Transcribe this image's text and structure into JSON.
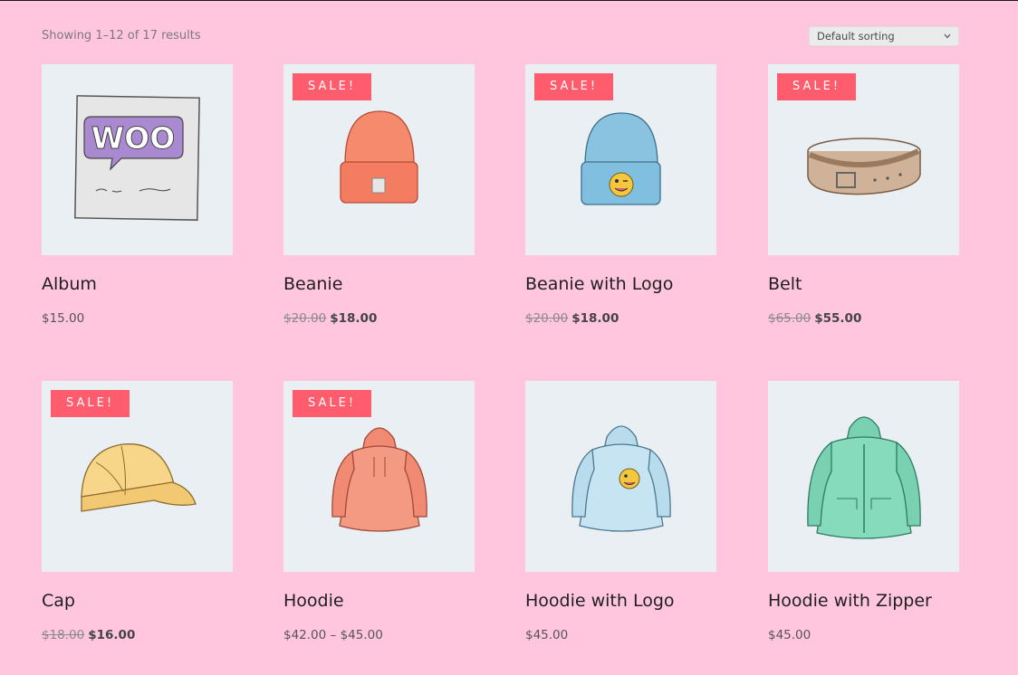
{
  "result_count": "Showing 1–12 of 17 results",
  "sorting": {
    "selected": "Default sorting"
  },
  "colors": {
    "background": "#ffc6de",
    "card": "#e9eff3",
    "sale_badge": "#ff5c6d"
  },
  "sale_label": "SALE!",
  "products": [
    {
      "title": "Album",
      "image": "album-icon",
      "sale": false,
      "price": "$15.00"
    },
    {
      "title": "Beanie",
      "image": "beanie-icon",
      "sale": true,
      "old_price": "$20.00",
      "new_price": "$18.00"
    },
    {
      "title": "Beanie with Logo",
      "image": "beanie-logo-icon",
      "sale": true,
      "old_price": "$20.00",
      "new_price": "$18.00"
    },
    {
      "title": "Belt",
      "image": "belt-icon",
      "sale": true,
      "old_price": "$65.00",
      "new_price": "$55.00"
    },
    {
      "title": "Cap",
      "image": "cap-icon",
      "sale": true,
      "old_price": "$18.00",
      "new_price": "$16.00"
    },
    {
      "title": "Hoodie",
      "image": "hoodie-icon",
      "sale": true,
      "price": "$42.00 – $45.00"
    },
    {
      "title": "Hoodie with Logo",
      "image": "hoodie-logo-icon",
      "sale": false,
      "price": "$45.00"
    },
    {
      "title": "Hoodie with Zipper",
      "image": "hoodie-zipper-icon",
      "sale": false,
      "price": "$45.00"
    }
  ]
}
